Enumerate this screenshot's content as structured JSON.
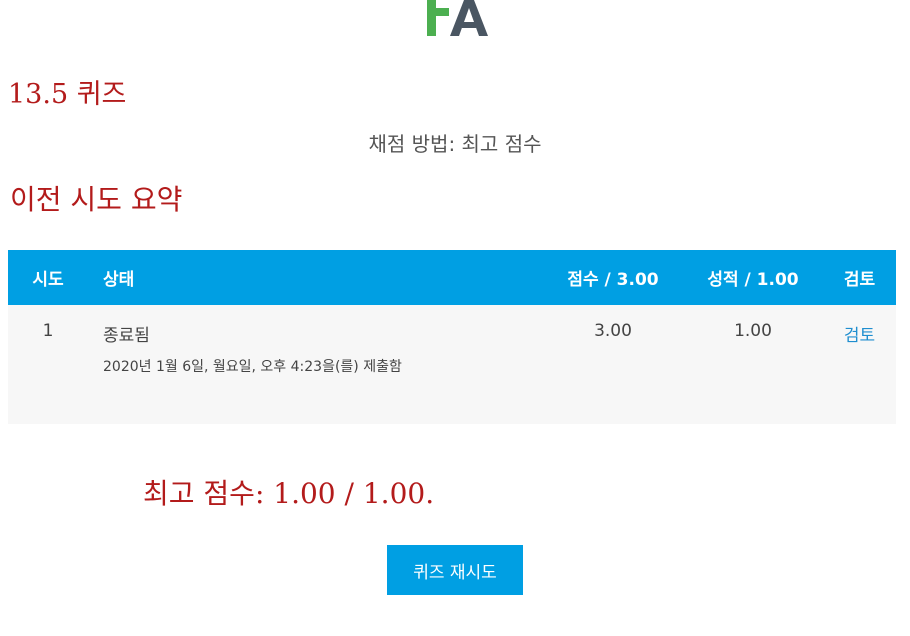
{
  "quiz_title": "13.5 퀴즈",
  "grading_method": "채점 방법: 최고 점수",
  "summary_title": "이전 시도 요약",
  "table": {
    "headers": [
      "시도",
      "상태",
      "점수 / 3.00",
      "성적 / 1.00",
      "검토"
    ],
    "rows": [
      {
        "attempt": "1",
        "state": "종료됨",
        "submitted": "2020년 1월 6일, 월요일, 오후 4:23을(를) 제출함",
        "score": "3.00",
        "grade": "1.00",
        "review": "검토"
      }
    ]
  },
  "best_score": "최고 점수: 1.00 / 1.00.",
  "retry_label": "퀴즈 재시도",
  "colors": {
    "accent": "#009fe3",
    "heading": "#b31b1b",
    "logo_green": "#4caf50",
    "logo_slate": "#4a5662"
  }
}
